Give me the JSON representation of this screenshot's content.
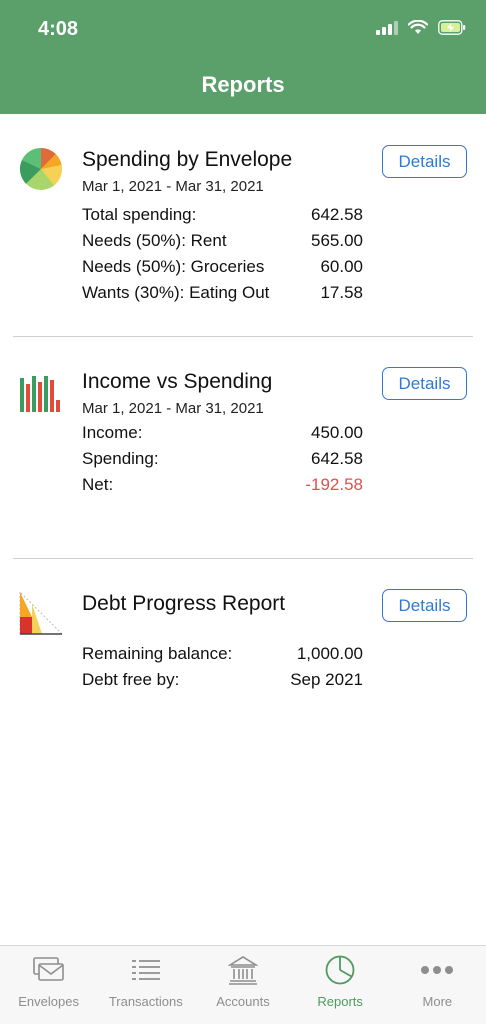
{
  "status": {
    "time": "4:08"
  },
  "header": {
    "title": "Reports"
  },
  "cards": [
    {
      "title": "Spending by Envelope",
      "date_range": "Mar 1, 2021 - Mar 31, 2021",
      "details_label": "Details",
      "rows": [
        {
          "label": "Total spending:",
          "value": "642.58"
        },
        {
          "label": "Needs (50%): Rent",
          "value": "565.00"
        },
        {
          "label": "Needs (50%): Groceries",
          "value": "60.00"
        },
        {
          "label": "Wants (30%): Eating Out",
          "value": "17.58"
        }
      ]
    },
    {
      "title": "Income vs Spending",
      "date_range": "Mar 1, 2021 - Mar 31, 2021",
      "details_label": "Details",
      "rows": [
        {
          "label": "Income:",
          "value": "450.00"
        },
        {
          "label": "Spending:",
          "value": "642.58"
        },
        {
          "label": "Net:",
          "value": "-192.58"
        }
      ]
    },
    {
      "title": "Debt Progress Report",
      "details_label": "Details",
      "rows": [
        {
          "label": "Remaining balance:",
          "value": "1,000.00"
        },
        {
          "label": "Debt free by:",
          "value": "Sep 2021"
        }
      ]
    }
  ],
  "tabs": [
    {
      "label": "Envelopes",
      "icon": "envelopes-icon"
    },
    {
      "label": "Transactions",
      "icon": "transactions-icon"
    },
    {
      "label": "Accounts",
      "icon": "accounts-bank-icon"
    },
    {
      "label": "Reports",
      "icon": "reports-pie-icon",
      "active": true
    },
    {
      "label": "More",
      "icon": "more-dots-icon"
    }
  ],
  "colors": {
    "header": "#5ba06a",
    "accent_blue": "#2f7bd1",
    "negative": "#d9534f",
    "active_tab": "#4f9a5e"
  }
}
